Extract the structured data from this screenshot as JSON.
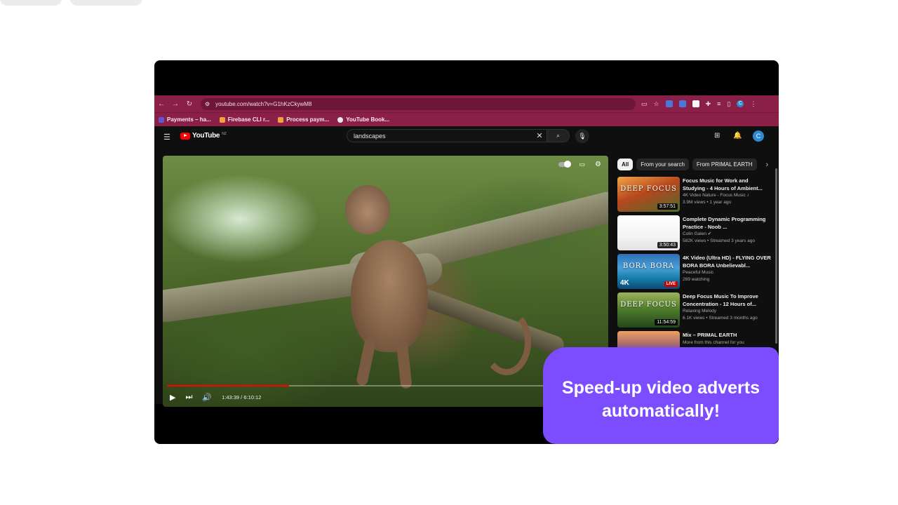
{
  "browser": {
    "url": "youtube.com/watch?v=G1hKzCkywM8",
    "bookmarks": [
      {
        "label": "Payments – ha..."
      },
      {
        "label": "Firebase CLI r..."
      },
      {
        "label": "Process paym..."
      },
      {
        "label": "YouTube Book..."
      }
    ],
    "avatar_letter": "C"
  },
  "youtube": {
    "logo_text": "YouTube",
    "region": "NZ",
    "search_query": "landscapes",
    "avatar_letter": "C",
    "player": {
      "time": "1:43:39 / 6:10:12",
      "progress_fraction": 0.28
    },
    "chips": [
      "All",
      "From your search",
      "From PRIMAL EARTH"
    ],
    "recommendations": [
      {
        "title": "Focus Music for Work and Studying - 4 Hours of Ambient...",
        "channel": "4K Video Nature - Focus Music ♪",
        "stats": "3.9M views • 1 year ago",
        "duration": "3:57:51",
        "thumb_text": "DEEP FOCUS",
        "thumb": "t1"
      },
      {
        "title": "Complete Dynamic Programming Practice - Noob ...",
        "channel": "Colin Galen ✔",
        "stats": "582K views • Streamed 3 years ago",
        "duration": "3:50:43",
        "thumb_text": "",
        "thumb": "t2"
      },
      {
        "title": "4K Video (Ultra HD) - FLYING OVER BORA BORA Unbelievabl...",
        "channel": "Peaceful Music",
        "stats": "269 watching",
        "duration": "LIVE",
        "thumb_text": "BORA BORA",
        "thumb": "t3",
        "thumb_badge": "4K"
      },
      {
        "title": "Deep Focus Music To Improve Concentration - 12 Hours of...",
        "channel": "Relaxing Melody",
        "stats": "6.1K views • Streamed 3 months ago",
        "duration": "11:54:59",
        "thumb_text": "DEEP FOCUS",
        "thumb": "t4"
      },
      {
        "title": "Mix – PRIMAL EARTH",
        "channel": "More from this channel for you",
        "stats": "",
        "duration": "",
        "thumb_text": "",
        "thumb": "t5"
      }
    ]
  },
  "promo": {
    "line1": "Speed-up video adverts",
    "line2": "automatically!"
  },
  "colors": {
    "browser_theme": "#8a1f47",
    "promo_bg": "#7c4dff",
    "yt_bg": "#0f0f0f"
  }
}
